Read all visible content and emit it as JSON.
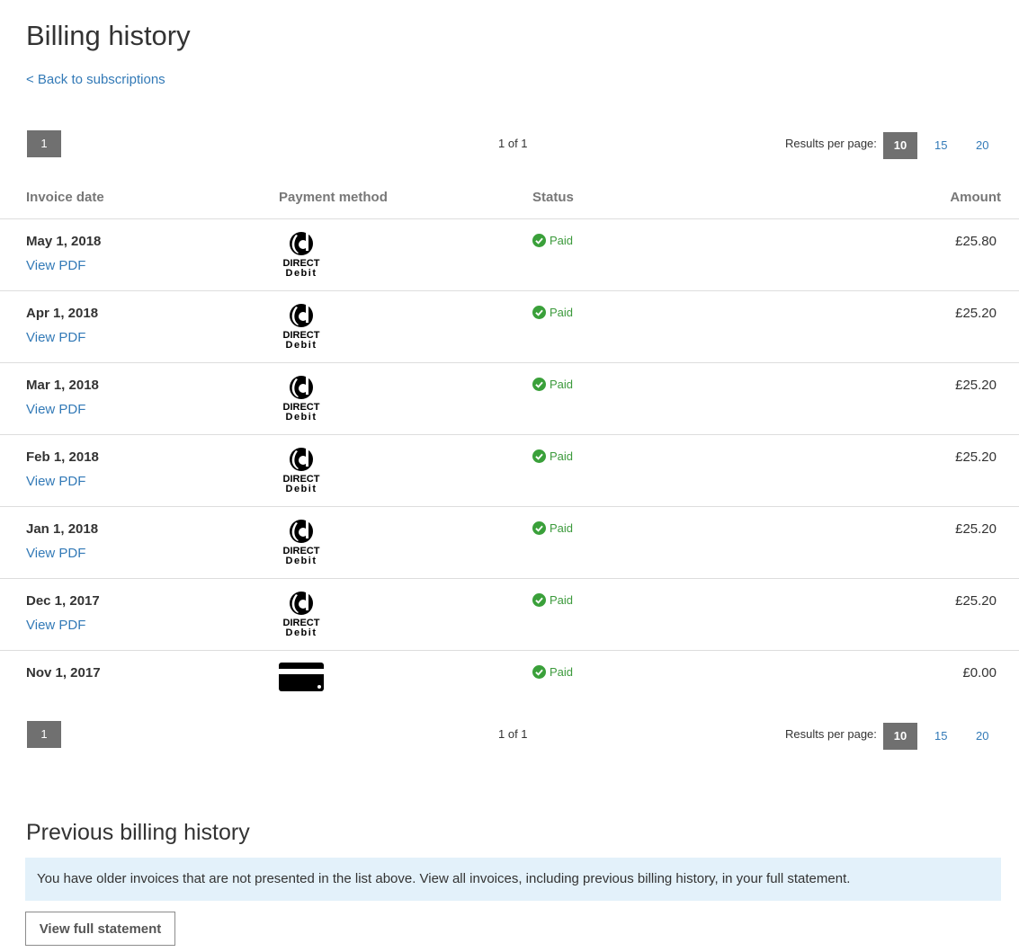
{
  "page": {
    "title": "Billing history",
    "back_link": "< Back to subscriptions"
  },
  "pagination": {
    "current_page": "1",
    "page_count": "1 of 1",
    "results_per_page_label": "Results per page:",
    "results_per_page_options": [
      "10",
      "15",
      "20"
    ],
    "results_per_page_selected": "10"
  },
  "table": {
    "columns": [
      "Invoice date",
      "Payment method",
      "Status",
      "Amount"
    ],
    "rows": [
      {
        "date": "May 1, 2018",
        "pdf_link": "View PDF",
        "payment_method": "direct-debit-icon",
        "status": "Paid",
        "amount": "£25.80"
      },
      {
        "date": "Apr 1, 2018",
        "pdf_link": "View PDF",
        "payment_method": "direct-debit-icon",
        "status": "Paid",
        "amount": "£25.20"
      },
      {
        "date": "Mar 1, 2018",
        "pdf_link": "View PDF",
        "payment_method": "direct-debit-icon",
        "status": "Paid",
        "amount": "£25.20"
      },
      {
        "date": "Feb 1, 2018",
        "pdf_link": "View PDF",
        "payment_method": "direct-debit-icon",
        "status": "Paid",
        "amount": "£25.20"
      },
      {
        "date": "Jan 1, 2018",
        "pdf_link": "View PDF",
        "payment_method": "direct-debit-icon",
        "status": "Paid",
        "amount": "£25.20"
      },
      {
        "date": "Dec 1, 2017",
        "pdf_link": "View PDF",
        "payment_method": "direct-debit-icon",
        "status": "Paid",
        "amount": "£25.20"
      },
      {
        "date": "Nov 1, 2017",
        "pdf_link": "",
        "payment_method": "credit-card-icon",
        "status": "Paid",
        "amount": "£0.00"
      }
    ]
  },
  "previous_billing": {
    "title": "Previous billing history",
    "message": "You have older invoices that are not presented in the list above. View all invoices, including previous billing history, in your full statement.",
    "button_label": "View full statement"
  },
  "colors": {
    "link": "#337ab7",
    "paid": "#3c9a3c",
    "pager_active": "#707070",
    "info_background": "#e3f1fa"
  }
}
